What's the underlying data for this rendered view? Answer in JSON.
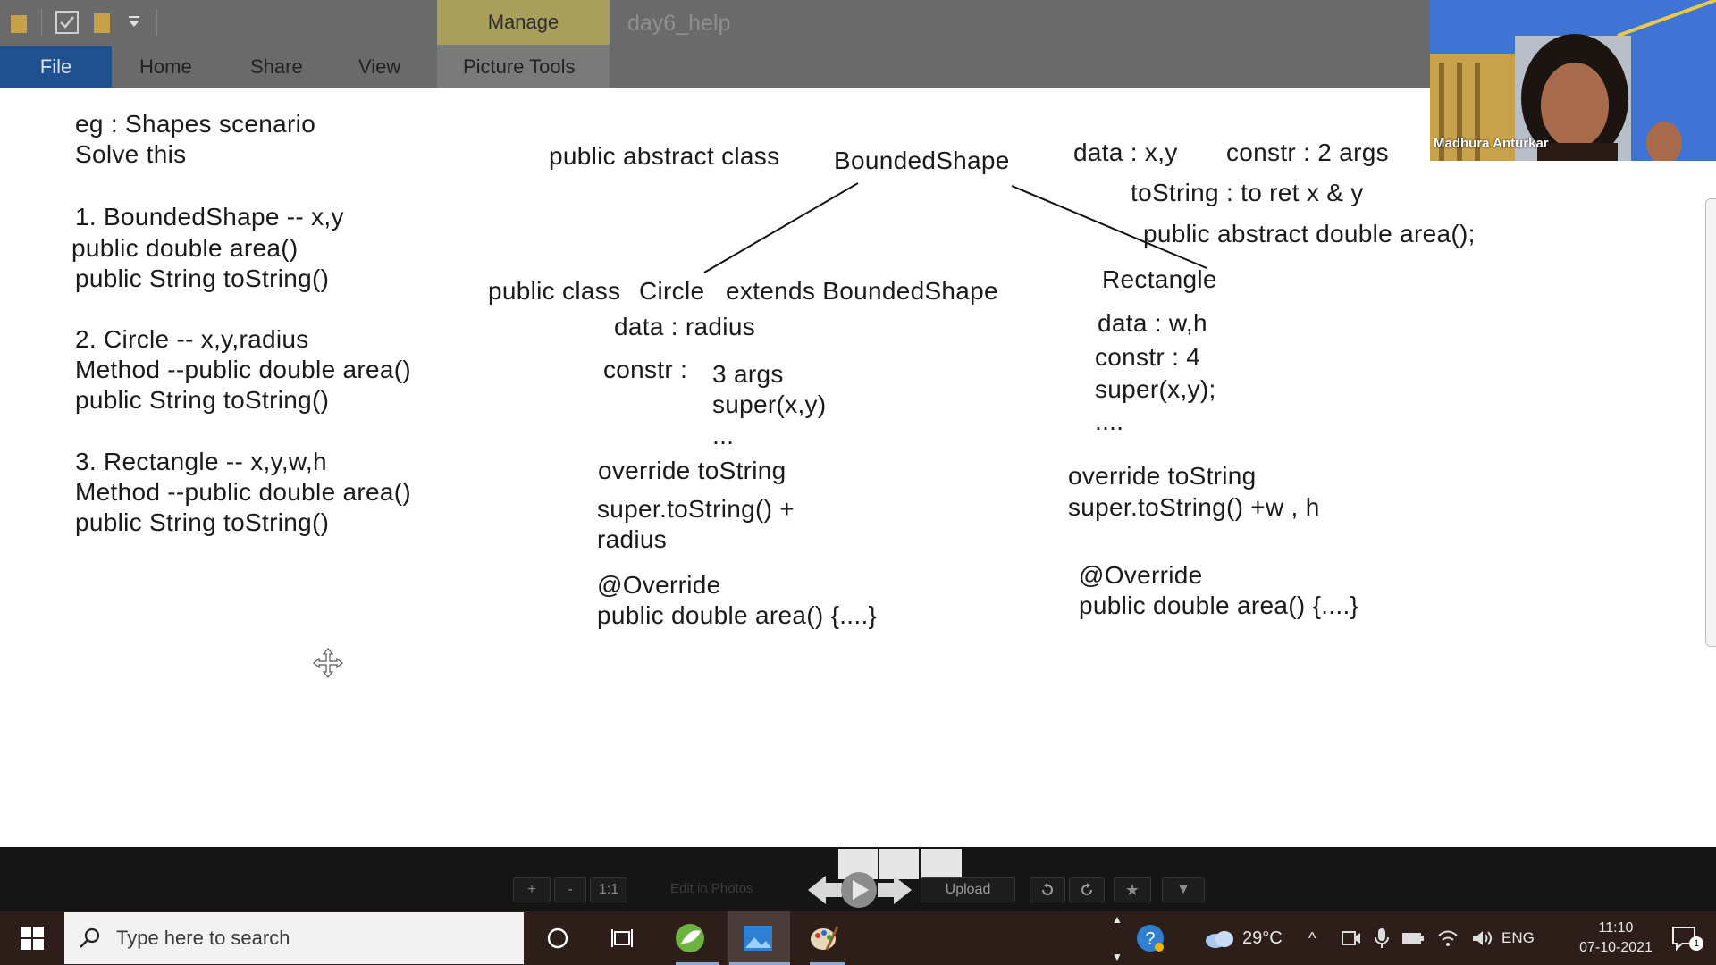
{
  "ribbon": {
    "manage_label": "Manage",
    "window_title": "day6_help",
    "tabs": [
      "File",
      "Home",
      "Share",
      "View",
      "Picture Tools"
    ]
  },
  "webcam": {
    "name": "Madhura Anturkar"
  },
  "slide": {
    "left_col": [
      "eg : Shapes scenario",
      "Solve this",
      "1. BoundedShape -- x,y",
      "public double area()",
      "public String toString()",
      "2. Circle -- x,y,radius",
      "Method --public double area()",
      "public String toString()",
      "3. Rectangle -- x,y,w,h",
      "Method --public double area()",
      "public String toString()"
    ],
    "base": {
      "decl": "public abstract class",
      "name": "BoundedShape",
      "data": "data : x,y",
      "constr": "constr : 2 args",
      "tostring": "toString : to ret x & y",
      "abstract_method": "public abstract double area();"
    },
    "circle": {
      "decl": "public class",
      "name": "Circle",
      "extends": "extends BoundedShape",
      "data": "data : radius",
      "constr_label": "constr :",
      "constr_args": "3 args",
      "super_call": "super(x,y)",
      "ellipsis": "...",
      "override_tostring": "override toString",
      "super_tostring": "super.toString() +",
      "radius": "radius",
      "annotation": "@Override",
      "area": "public double area() {....}"
    },
    "rectangle": {
      "name": "Rectangle",
      "data": "data : w,h",
      "constr": "constr : 4",
      "super_call": "super(x,y);",
      "ellipsis": "....",
      "override_tostring": "override toString",
      "super_tostring": "super.toString() +w , h",
      "annotation": "@Override",
      "area": "public double area() {....}"
    }
  },
  "viewer_toolbar": {
    "zoom_in": "+",
    "zoom_out": "-",
    "actual_size": "1:1",
    "edit_label": "Edit in Photos",
    "upload": "Upload"
  },
  "taskbar": {
    "search_placeholder": "Type here to search",
    "temperature": "29°C",
    "language": "ENG",
    "time": "11:10",
    "date": "07-10-2021",
    "notification_count": "1"
  },
  "colors": {
    "ribbon": "#6a6a6a",
    "file_tab": "#20508e",
    "manage_tab": "#a8a05a",
    "taskbar": "#2d1e1a"
  }
}
